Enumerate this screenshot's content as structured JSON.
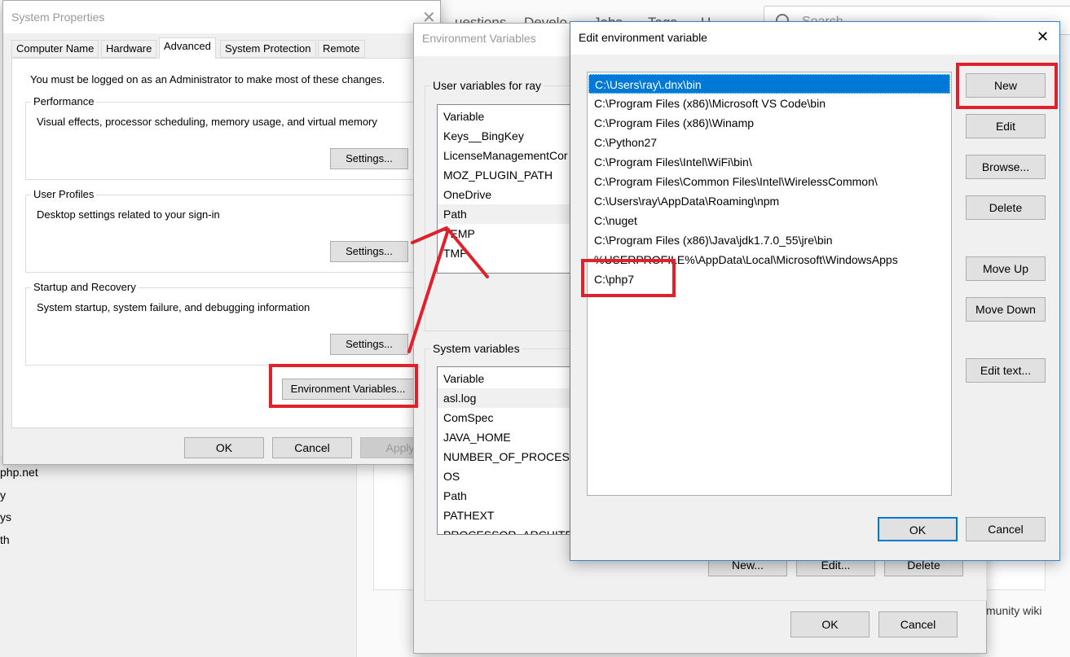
{
  "background": {
    "nav": [
      "uestions",
      "Develo",
      "Jobs",
      "Tags",
      "U"
    ],
    "search_placeholder": "Search",
    "left_fragments": [
      "php.net",
      "y",
      "ys",
      "th"
    ],
    "right_fragment": "munity wiki"
  },
  "system_properties": {
    "title": "System Properties",
    "tabs": [
      "Computer Name",
      "Hardware",
      "Advanced",
      "System Protection",
      "Remote"
    ],
    "active_tab": "Advanced",
    "admin_note": "You must be logged on as an Administrator to make most of these changes.",
    "groups": [
      {
        "label": "Performance",
        "desc": "Visual effects, processor scheduling, memory usage, and virtual memory",
        "button": "Settings..."
      },
      {
        "label": "User Profiles",
        "desc": "Desktop settings related to your sign-in",
        "button": "Settings..."
      },
      {
        "label": "Startup and Recovery",
        "desc": "System startup, system failure, and debugging information",
        "button": "Settings..."
      }
    ],
    "env_button": "Environment Variables...",
    "ok": "OK",
    "cancel": "Cancel",
    "apply": "Apply"
  },
  "environment_variables": {
    "title": "Environment Variables",
    "user_group": "User variables for ray",
    "user_vars": [
      "Variable",
      "Keys__BingKey",
      "LicenseManagementCor",
      "MOZ_PLUGIN_PATH",
      "OneDrive",
      "Path",
      "TEMP",
      "TMP"
    ],
    "system_group": "System variables",
    "system_vars": [
      "Variable",
      "asl.log",
      "ComSpec",
      "JAVA_HOME",
      "NUMBER_OF_PROCESSO",
      "OS",
      "Path",
      "PATHEXT",
      "PROCESSOR_ARCHITEC"
    ],
    "new": "New...",
    "edit": "Edit...",
    "delete": "Delete",
    "ok": "OK",
    "cancel": "Cancel"
  },
  "edit_env": {
    "title": "Edit environment variable",
    "items": [
      "C:\\Users\\ray\\.dnx\\bin",
      "C:\\Program Files (x86)\\Microsoft VS Code\\bin",
      "C:\\Program Files (x86)\\Winamp",
      "C:\\Python27",
      "C:\\Program Files\\Intel\\WiFi\\bin\\",
      "C:\\Program Files\\Common Files\\Intel\\WirelessCommon\\",
      "C:\\Users\\ray\\AppData\\Roaming\\npm",
      "C:\\nuget",
      "C:\\Program Files (x86)\\Java\\jdk1.7.0_55\\jre\\bin",
      "%USERPROFILE%\\AppData\\Local\\Microsoft\\WindowsApps",
      "C:\\php7"
    ],
    "buttons": {
      "new": "New",
      "edit": "Edit",
      "browse": "Browse...",
      "delete": "Delete",
      "move_up": "Move Up",
      "move_down": "Move Down",
      "edit_text": "Edit text..."
    },
    "ok": "OK",
    "cancel": "Cancel"
  },
  "colors": {
    "annotation": "#e0202a",
    "selection": "#0078d7",
    "focus_border": "#0078d7"
  }
}
